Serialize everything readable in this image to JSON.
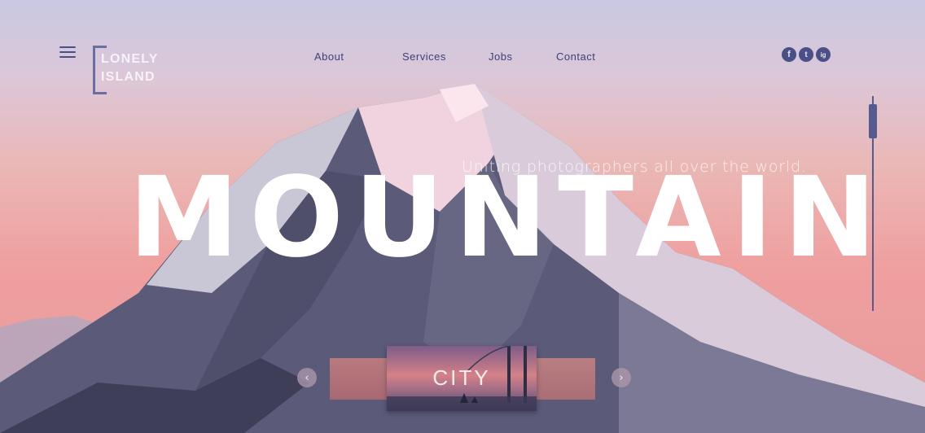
{
  "brand": {
    "line1": "LONELY",
    "line2": "ISLAND"
  },
  "nav": {
    "items": [
      "About",
      "Services",
      "Jobs",
      "Contact"
    ]
  },
  "social": {
    "icons": [
      "facebook-icon",
      "twitter-icon",
      "instagram-icon"
    ],
    "glyphs": [
      "f",
      "t",
      "ig"
    ]
  },
  "hero": {
    "title": "MOUNTAIN",
    "tagline": "Uniting photographers all over the world."
  },
  "carousel": {
    "current_label": "CITY",
    "prev_glyph": "‹",
    "next_glyph": "›"
  },
  "colors": {
    "accent": "#4a4f86",
    "text_light": "#ffffff",
    "sky_top": "#c9c8e2",
    "sky_bottom": "#ef9f9e"
  }
}
